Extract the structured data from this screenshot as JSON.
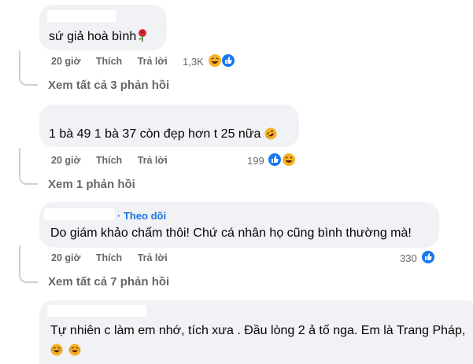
{
  "comments": [
    {
      "text": "sứ giả hoà bình",
      "time": "20 giờ",
      "like": "Thích",
      "reply": "Trả lời",
      "reactions": "1,3K",
      "more_replies": "Xem tất cả 3 phản hồi"
    },
    {
      "text": "1 bà 49 1 bà 37 còn đẹp hơn t 25 nữa",
      "time": "20 giờ",
      "like": "Thích",
      "reply": "Trả lời",
      "reactions": "199",
      "more_replies": "Xem 1 phản hồi"
    },
    {
      "follow": "· Theo dõi",
      "text": "Do giám khảo chấm thôi! Chứ cá nhân họ cũng bình thường mà!",
      "time": "20 giờ",
      "like": "Thích",
      "reply": "Trả lời",
      "reactions": "330",
      "more_replies": "Xem tất cả 7 phản hồi"
    },
    {
      "text": "Tự nhiên c làm em nhớ, tích xưa . Đầu lòng 2 ả tố nga. Em là Trang Pháp,"
    }
  ],
  "colors": {
    "bubble": "#f0f2f5",
    "meta": "#65676b",
    "link": "#1b74e4",
    "like_blue": "#1877f2",
    "haha_yellow": "#f7b125"
  },
  "icons": [
    "rose-emoji",
    "like-reaction-icon",
    "haha-reaction-icon",
    "rofl-emoji"
  ]
}
